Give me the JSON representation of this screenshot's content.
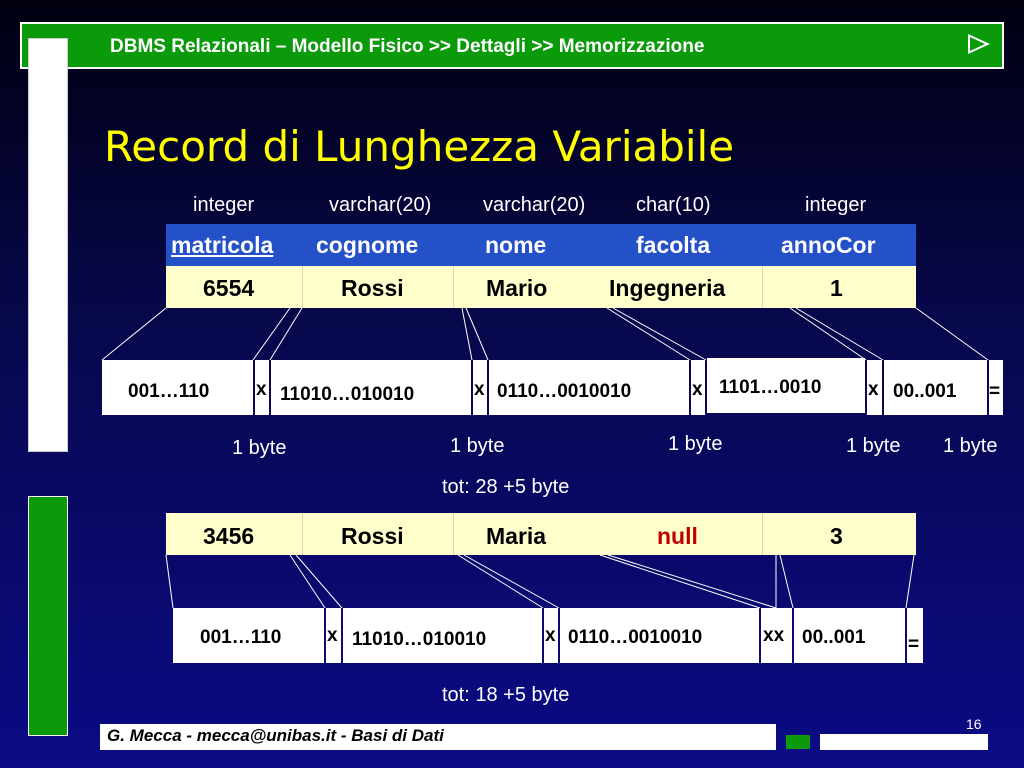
{
  "header": {
    "title": "DBMS Relazionali – Modello Fisico >> Dettagli >> Memorizzazione"
  },
  "slide": {
    "title": "Record di Lunghezza Variabile"
  },
  "types": [
    "integer",
    "varchar(20)",
    "varchar(20)",
    "char(10)",
    "integer"
  ],
  "columns": [
    "matricola",
    "cognome",
    "nome",
    "facolta",
    "annoCor"
  ],
  "record1": {
    "values": [
      "6554",
      "Rossi",
      "Mario",
      "Ingegneria",
      "1"
    ],
    "bytes": {
      "b1": "001…110",
      "x1": "x",
      "b2": "11010…010010",
      "x2": "x",
      "b3": "0110…0010010",
      "x3": "x",
      "b4": "1101…0010",
      "x4": "x",
      "b5": "00..001",
      "eq": "="
    },
    "byte_labels": [
      "1 byte",
      "1 byte",
      "1 byte",
      "1 byte",
      "1 byte"
    ],
    "total": "tot: 28 +5 byte"
  },
  "record2": {
    "values": [
      "3456",
      "Rossi",
      "Maria",
      "null",
      "3"
    ],
    "bytes": {
      "b1": "001…110",
      "x1": "x",
      "b2": "11010…010010",
      "x2": "x",
      "b3": "0110…0010010",
      "xx": "xx",
      "b5": "00..001",
      "eq": "="
    },
    "total": "tot: 18 +5 byte"
  },
  "footer": {
    "text": "G. Mecca - mecca@unibas.it - Basi di Dati",
    "page": "16"
  },
  "colors": {
    "green": "#0a9a0a",
    "yellow": "#ffff00",
    "header_row": "#2451c8",
    "value_row": "#ffffcc",
    "null_red": "#c00000"
  }
}
